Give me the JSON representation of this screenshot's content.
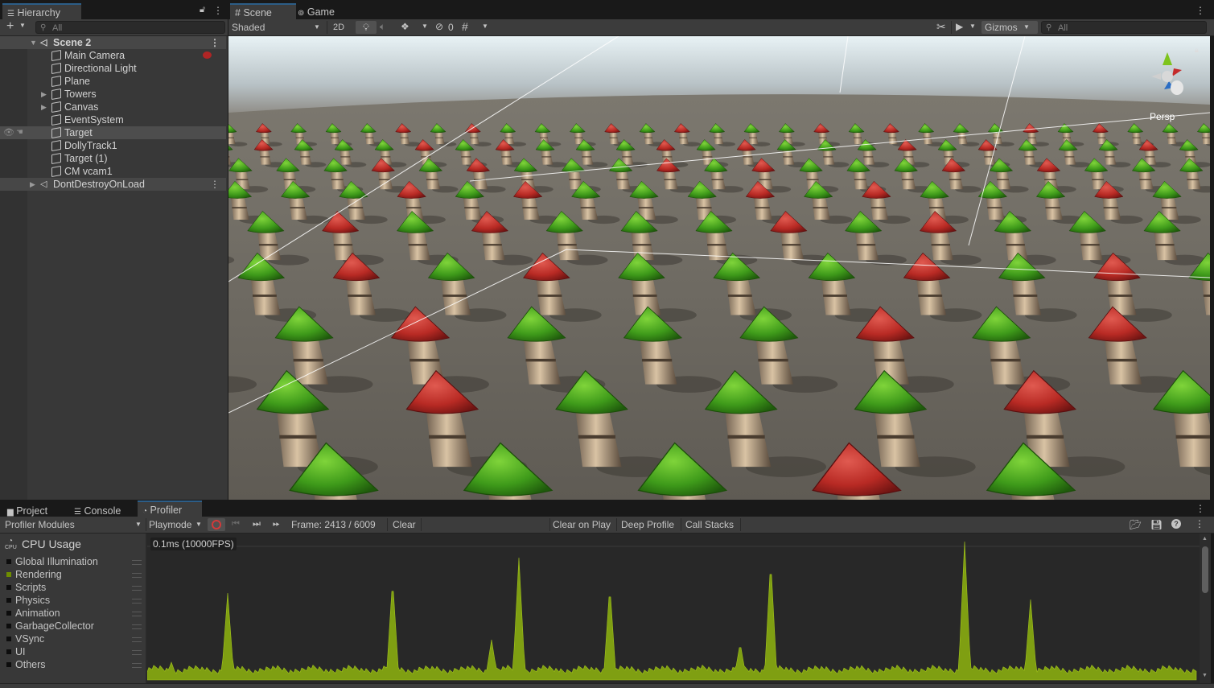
{
  "hierarchy": {
    "tab_label": "Hierarchy",
    "search_placeholder": "All",
    "rows": [
      {
        "label": "Scene 2"
      },
      {
        "label": "Main Camera"
      },
      {
        "label": "Directional Light"
      },
      {
        "label": "Plane"
      },
      {
        "label": "Towers"
      },
      {
        "label": "Canvas"
      },
      {
        "label": "EventSystem"
      },
      {
        "label": "Target"
      },
      {
        "label": "DollyTrack1"
      },
      {
        "label": "Target (1)"
      },
      {
        "label": "CM vcam1"
      },
      {
        "label": "DontDestroyOnLoad"
      }
    ]
  },
  "scene_tabs": {
    "scene_label": "Scene",
    "game_label": "Game"
  },
  "scene_toolbar": {
    "shading_mode": "Shaded",
    "mode_2d": "2D",
    "hidden_count": "0",
    "gizmos_label": "Gizmos",
    "search_placeholder": "All",
    "projection_label": "Persp"
  },
  "bottom_tabs": {
    "project_label": "Project",
    "console_label": "Console",
    "profiler_label": "Profiler"
  },
  "profiler": {
    "modules_dropdown": "Profiler Modules",
    "target_dropdown": "Playmode",
    "frame_label": "Frame: 2413 / 6009",
    "clear_label": "Clear",
    "clear_on_play_label": "Clear on Play",
    "deep_profile_label": "Deep Profile",
    "call_stacks_label": "Call Stacks",
    "cpu_usage_title": "CPU Usage",
    "cpu_icon_text": "CPU",
    "threshold_label": "0.1ms (10000FPS)",
    "modules": [
      {
        "label": "Global Illumination",
        "color": "#0d0d0d"
      },
      {
        "label": "Rendering",
        "color": "#6e8d00"
      },
      {
        "label": "Scripts",
        "color": "#0d0d0d"
      },
      {
        "label": "Physics",
        "color": "#0d0d0d"
      },
      {
        "label": "Animation",
        "color": "#0d0d0d"
      },
      {
        "label": "GarbageCollector",
        "color": "#0d0d0d"
      },
      {
        "label": "VSync",
        "color": "#0d0d0d"
      },
      {
        "label": "UI",
        "color": "#0d0d0d"
      },
      {
        "label": "Others",
        "color": "#0d0d0d"
      }
    ]
  },
  "colors": {
    "chart_fill": "#7f9f12",
    "chart_stroke": "#a2c41c",
    "record_red": "#d23a3a",
    "selection": "#2c5d87"
  }
}
